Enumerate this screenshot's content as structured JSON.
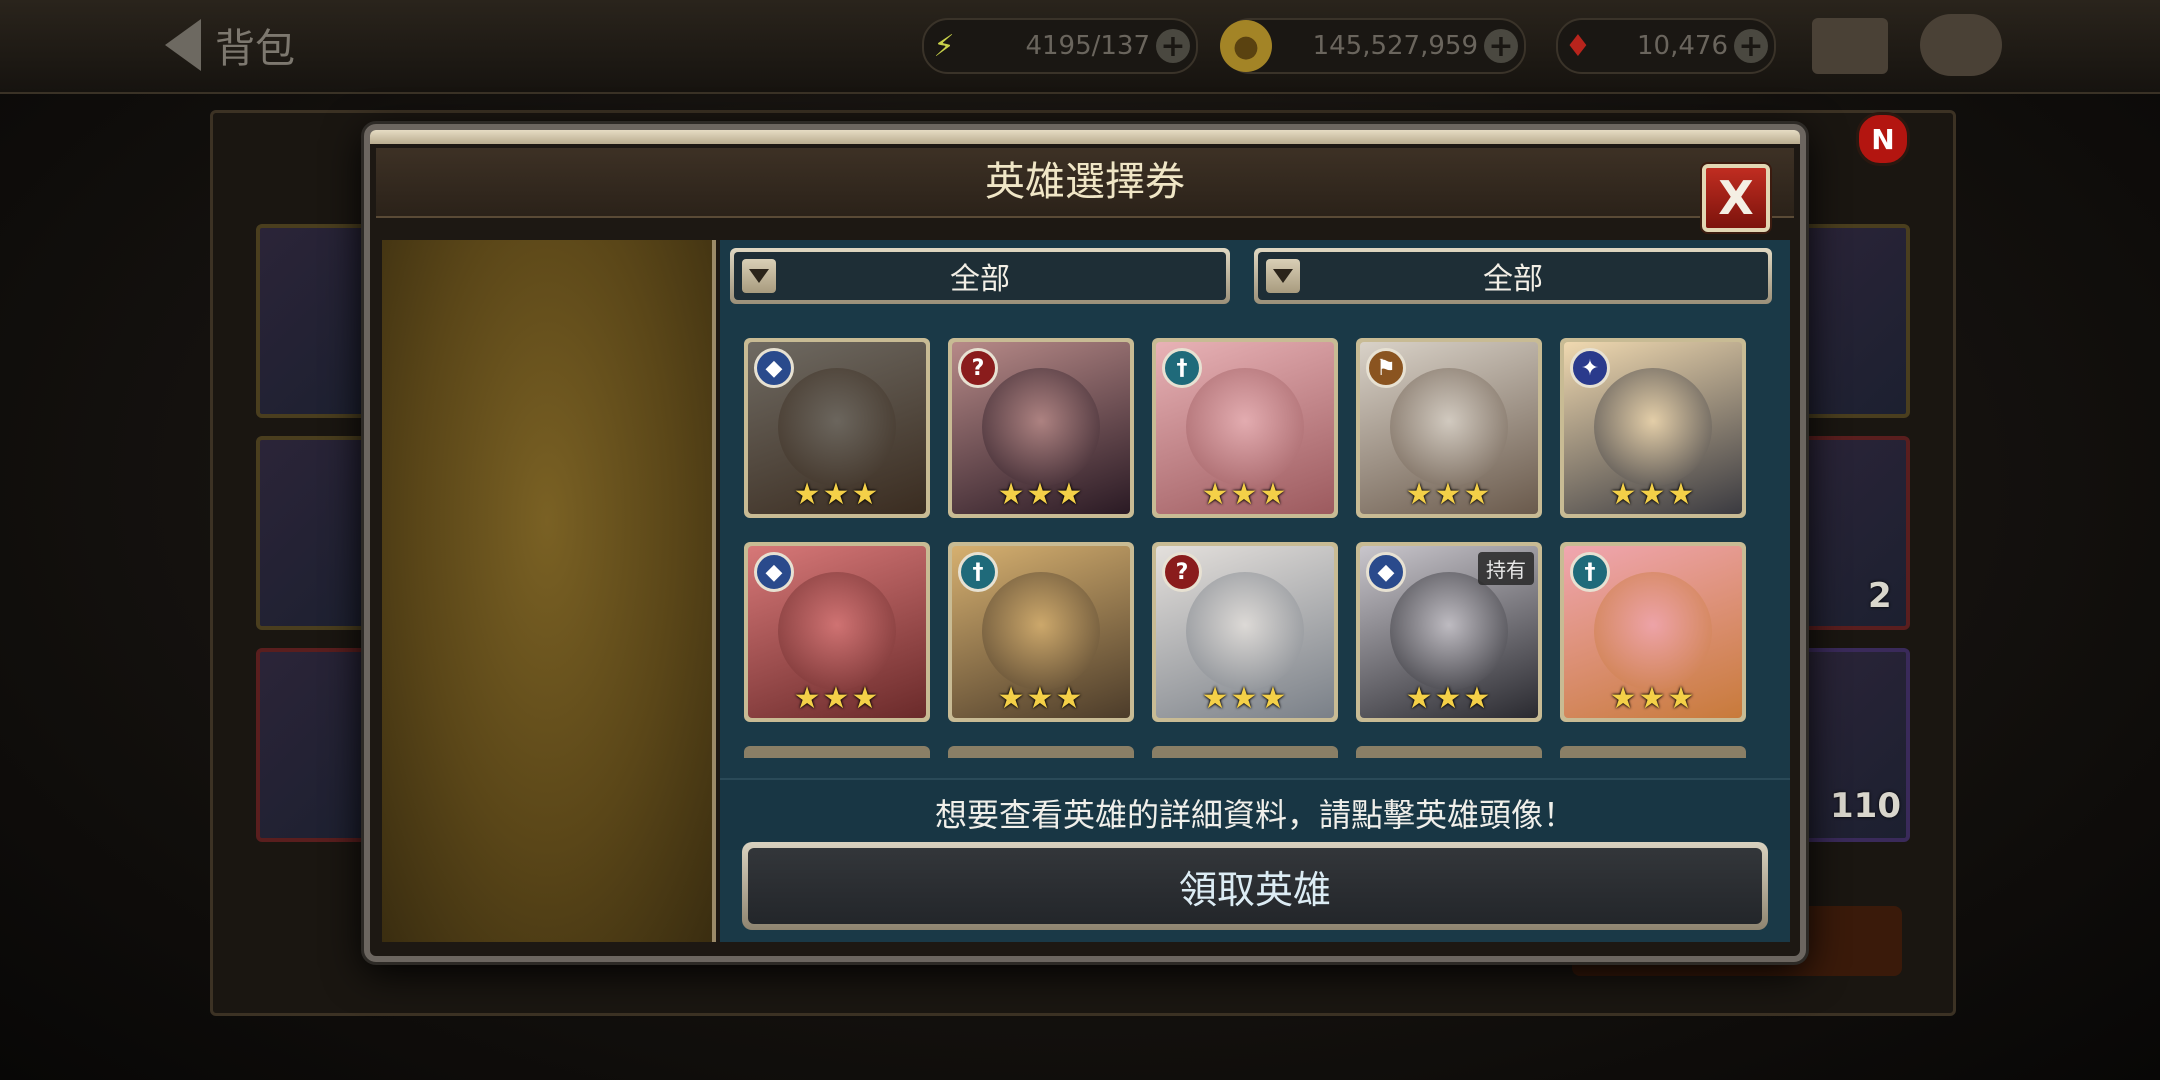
{
  "topbar": {
    "back_label": "背包",
    "resources": [
      {
        "name": "energy",
        "value": "4195/137",
        "icon": "lightning-icon",
        "color": "#c9d24a"
      },
      {
        "name": "gold",
        "value": "145,527,959",
        "icon": "coin-icon",
        "color": "#d6b23a"
      },
      {
        "name": "gems",
        "value": "10,476",
        "icon": "ruby-icon",
        "color": "#c8231c"
      }
    ],
    "plus_symbol": "+"
  },
  "background": {
    "notification_badge": "N",
    "counts": [
      "2",
      "110"
    ]
  },
  "dialog": {
    "title": "英雄選擇券",
    "close_symbol": "X",
    "filters": [
      {
        "label": "全部"
      },
      {
        "label": "全部"
      }
    ],
    "heroes": [
      {
        "class_icon": "shield-icon",
        "class_color": "#2a4a8c",
        "glyph": "◆",
        "stars": "★★★",
        "owned": "",
        "portrait": [
          "#6f6a62",
          "#3a2c20"
        ]
      },
      {
        "class_icon": "hook-icon",
        "class_color": "#8a1c1c",
        "glyph": "?",
        "stars": "★★★",
        "owned": "",
        "portrait": [
          "#b78a88",
          "#2a1a24"
        ]
      },
      {
        "class_icon": "cross-icon",
        "class_color": "#1f6a7a",
        "glyph": "†",
        "stars": "★★★",
        "owned": "",
        "portrait": [
          "#e8b2b6",
          "#9c5a5e"
        ]
      },
      {
        "class_icon": "flag-icon",
        "class_color": "#8a5420",
        "glyph": "⚑",
        "stars": "★★★",
        "owned": "",
        "portrait": [
          "#d9d2c8",
          "#6a5a4c"
        ]
      },
      {
        "class_icon": "gun-icon",
        "class_color": "#2a3a8c",
        "glyph": "✦",
        "stars": "★★★",
        "owned": "",
        "portrait": [
          "#f0d9b0",
          "#3a3a40"
        ]
      },
      {
        "class_icon": "shield-icon",
        "class_color": "#2a4a8c",
        "glyph": "◆",
        "stars": "★★★",
        "owned": "",
        "portrait": [
          "#d77878",
          "#6a2a2a"
        ]
      },
      {
        "class_icon": "cross-icon",
        "class_color": "#1f6a7a",
        "glyph": "†",
        "stars": "★★★",
        "owned": "",
        "portrait": [
          "#d6b070",
          "#4c3c2a"
        ]
      },
      {
        "class_icon": "hook-icon",
        "class_color": "#8a1c1c",
        "glyph": "?",
        "stars": "★★★",
        "owned": "",
        "portrait": [
          "#e4e0dc",
          "#7a8088"
        ]
      },
      {
        "class_icon": "shield-icon",
        "class_color": "#2a4a8c",
        "glyph": "◆",
        "stars": "★★★",
        "owned": "持有",
        "portrait": [
          "#c9c6cc",
          "#2a2a30"
        ]
      },
      {
        "class_icon": "cross-icon",
        "class_color": "#1f6a7a",
        "glyph": "†",
        "stars": "★★★",
        "owned": "",
        "portrait": [
          "#f0a6b0",
          "#c87a3a"
        ]
      }
    ],
    "hint": "想要查看英雄的詳細資料，請點擊英雄頭像！",
    "claim_button": "領取英雄"
  }
}
